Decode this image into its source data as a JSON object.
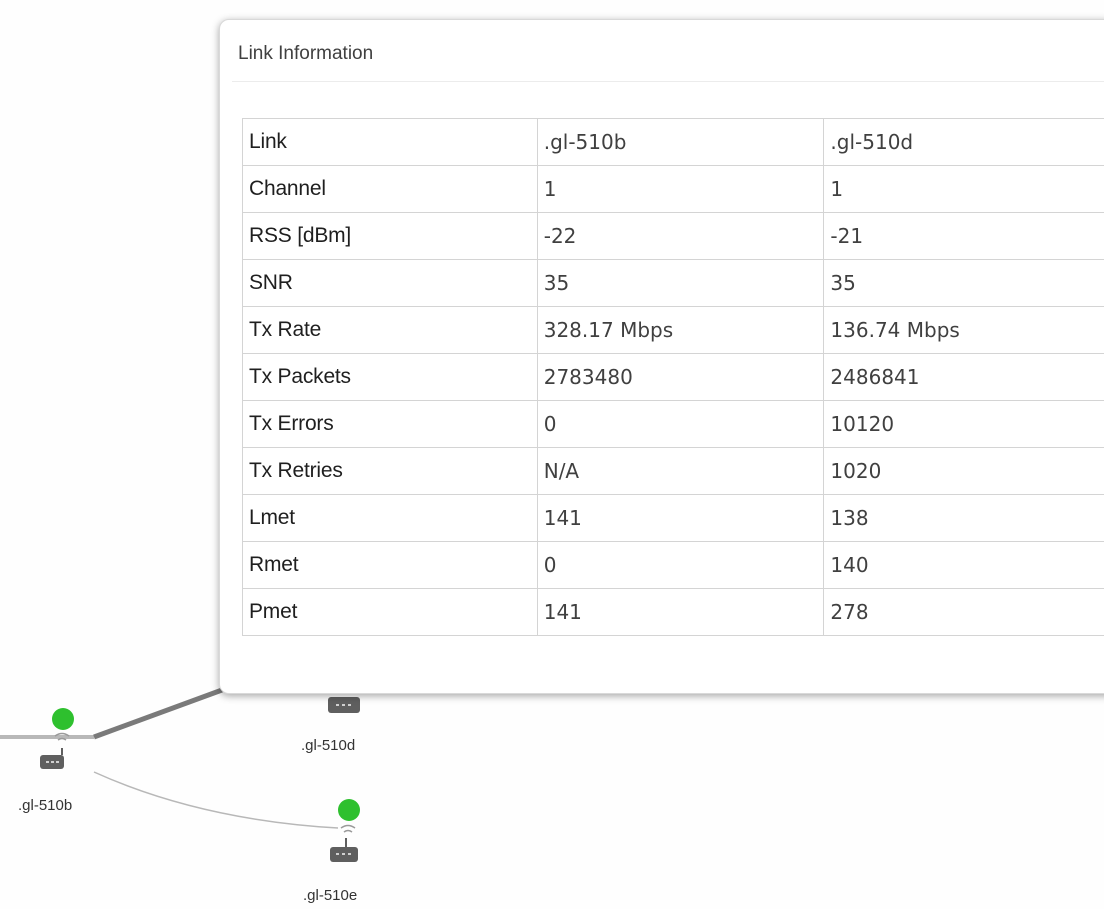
{
  "popup": {
    "title": "Link Information",
    "table": {
      "header": {
        "label": "Link",
        "col1": ".gl-510b",
        "col2": ".gl-510d"
      },
      "rows": [
        {
          "label": "Channel",
          "col1": "1",
          "col2": "1"
        },
        {
          "label": "RSS [dBm]",
          "col1": "-22",
          "col2": "-21"
        },
        {
          "label": "SNR",
          "col1": "35",
          "col2": "35"
        },
        {
          "label": "Tx Rate",
          "col1": "328.17 Mbps",
          "col2": "136.74 Mbps"
        },
        {
          "label": "Tx Packets",
          "col1": "2783480",
          "col2": "2486841"
        },
        {
          "label": "Tx Errors",
          "col1": "0",
          "col2": "10120"
        },
        {
          "label": "Tx Retries",
          "col1": "N/A",
          "col2": "1020"
        },
        {
          "label": "Lmet",
          "col1": "141",
          "col2": "138"
        },
        {
          "label": "Rmet",
          "col1": "0",
          "col2": "140"
        },
        {
          "label": "Pmet",
          "col1": "141",
          "col2": "278"
        }
      ]
    }
  },
  "topology": {
    "nodes": [
      {
        "label": ".gl-510b",
        "status": "online"
      },
      {
        "label": ".gl-510d",
        "status": "unknown"
      },
      {
        "label": ".gl-510e",
        "status": "online"
      }
    ]
  },
  "colors": {
    "online": "#2ec02e",
    "link_text": "#3f3ff0",
    "link_line_strong": "#7a7a7a",
    "link_line_weak": "#b8b8b8"
  }
}
